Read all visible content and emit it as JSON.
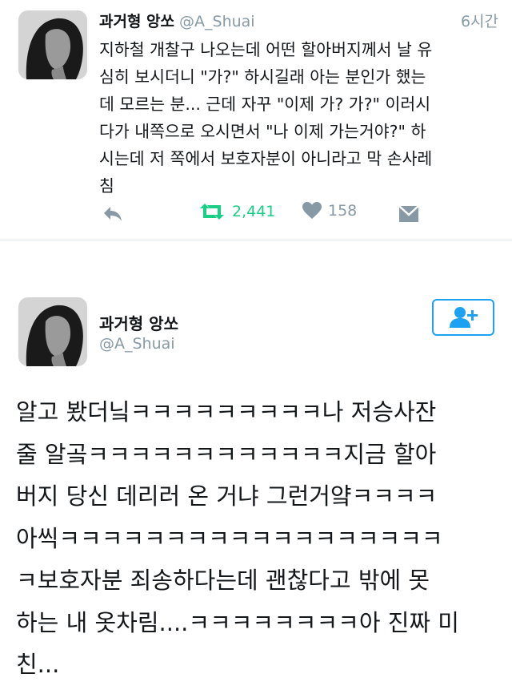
{
  "tweet1": {
    "name": "과거형 앙쏘",
    "handle": "@A_Shuai",
    "time": "6시간",
    "text_lines": [
      "지하철 개찰구 나오는데 어떤 할아버지께서 날 유",
      "심히 보시더니 \"가?\" 하시길래 아는 분인가 했는",
      "데 모르는 분... 근데 자꾸 \"이제 가? 가?\" 이러시",
      "다가 내쪽으로 오시면서 \"나 이제 가는거야?\" 하",
      "시는데 저 쪽에서 보호자분이 아니라고 막 손사레",
      "침"
    ],
    "retweet_count": "2,441",
    "like_count": "158",
    "colors": {
      "retweet": "#19cf86",
      "muted": "#8899a6"
    },
    "icons": {
      "reply": "reply-icon",
      "retweet": "retweet-icon",
      "like": "heart-icon",
      "dm": "envelope-icon"
    }
  },
  "tweet2": {
    "name": "과거형 앙쏘",
    "handle": "@A_Shuai",
    "follow_icon": "add-user-icon",
    "text_lines": [
      "알고 봤더닠ㅋㅋㅋㅋㅋㅋㅋㅋㅋ나 저승사잔",
      "줄 알곸ㅋㅋㅋㅋㅋㅋㅋㅋㅋㅋㅋㅋ지금 할아",
      "버지 당신 데리러 온 거냐 그런거얔ㅋㅋㅋㅋ",
      "아씩ㅋㅋㅋㅋㅋㅋㅋㅋㅋㅋㅋㅋㅋㅋㅋㅋㅋㅋ",
      "ㅋ보호자분 죄송하다는데 괜찮다고 밖에 못",
      "하는 내 옷차림....ㅋㅋㅋㅋㅋㅋㅋㅋ아 진짜 미",
      "친..."
    ],
    "colors": {
      "accent": "#1da1f2"
    }
  }
}
